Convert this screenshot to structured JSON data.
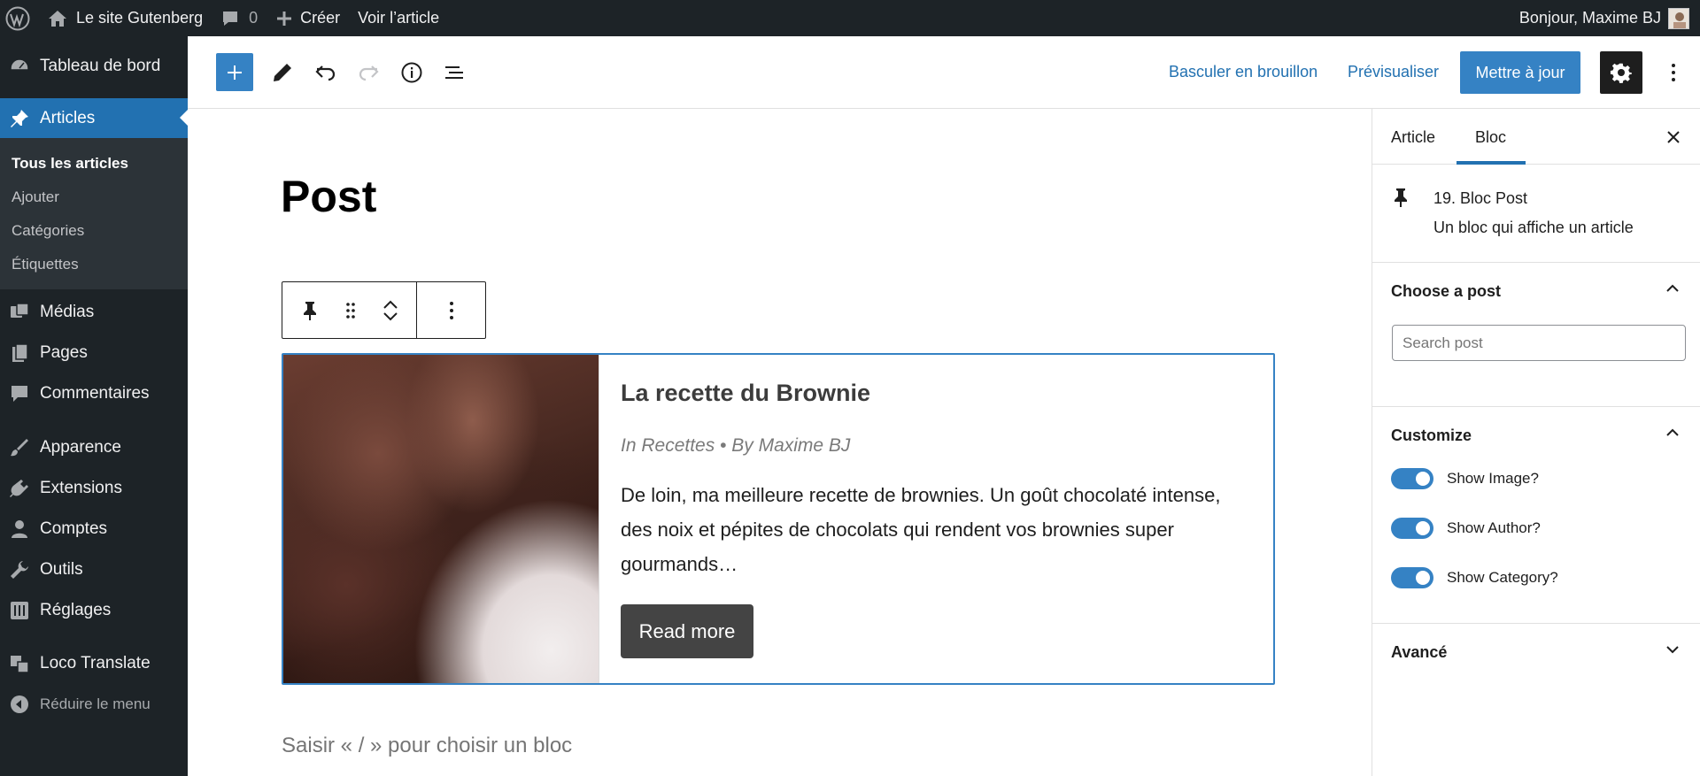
{
  "admin_bar": {
    "site_name": "Le site Gutenberg",
    "comments_count": "0",
    "new_label": "Créer",
    "view_label": "Voir l’article",
    "greeting": "Bonjour, Maxime BJ"
  },
  "sidebar": {
    "items": [
      {
        "label": "Tableau de bord",
        "icon": "dashboard-icon"
      },
      {
        "label": "Articles",
        "icon": "pin-icon"
      },
      {
        "label": "Médias",
        "icon": "media-icon"
      },
      {
        "label": "Pages",
        "icon": "pages-icon"
      },
      {
        "label": "Commentaires",
        "icon": "comments-icon"
      },
      {
        "label": "Apparence",
        "icon": "appearance-icon"
      },
      {
        "label": "Extensions",
        "icon": "plugins-icon"
      },
      {
        "label": "Comptes",
        "icon": "users-icon"
      },
      {
        "label": "Outils",
        "icon": "tools-icon"
      },
      {
        "label": "Réglages",
        "icon": "settings-icon"
      },
      {
        "label": "Loco Translate",
        "icon": "translate-icon"
      }
    ],
    "submenu": [
      "Tous les articles",
      "Ajouter",
      "Catégories",
      "Étiquettes"
    ],
    "collapse_label": "Réduire le menu"
  },
  "header": {
    "switch_draft": "Basculer en brouillon",
    "preview": "Prévisualiser",
    "update": "Mettre à jour"
  },
  "editor": {
    "post_title": "Post",
    "block": {
      "heading": "La recette du Brownie",
      "meta": "In Recettes • By Maxime BJ",
      "excerpt": "De loin, ma meilleure recette de brownies. Un goût chocolaté intense, des noix et pépites de chocolats qui rendent vos brownies super gourmands…",
      "read_more": "Read more"
    },
    "placeholder": "Saisir « / » pour choisir un bloc"
  },
  "inspector": {
    "tabs": [
      "Article",
      "Bloc"
    ],
    "active_tab": "Bloc",
    "block_title": "19. Bloc Post",
    "block_description": "Un bloc qui affiche un article",
    "choose_panel": "Choose a post",
    "search_placeholder": "Search post",
    "customize_panel": "Customize",
    "toggles": [
      {
        "label": "Show Image?",
        "on": true
      },
      {
        "label": "Show Author?",
        "on": true
      },
      {
        "label": "Show Category?",
        "on": true
      }
    ],
    "advanced_panel": "Avancé"
  },
  "colors": {
    "accent": "#3582c4",
    "admin_dark": "#1d2327",
    "current_menu": "#2271b1"
  }
}
